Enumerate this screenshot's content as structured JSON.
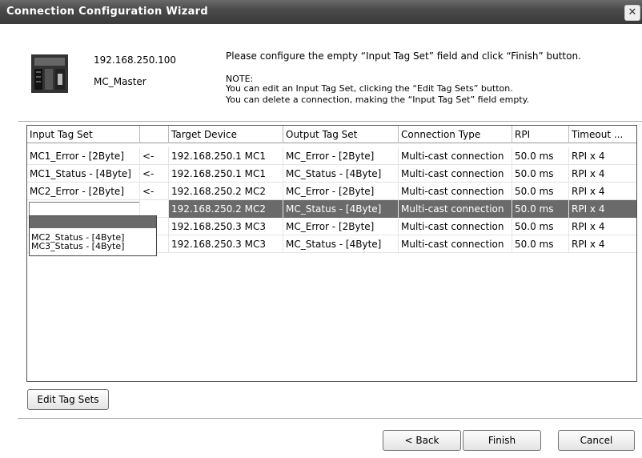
{
  "window": {
    "title": "Connection Configuration Wizard",
    "close_glyph": "✕"
  },
  "device": {
    "ip": "192.168.250.100",
    "name": "MC_Master",
    "icon": "plc-device-icon"
  },
  "instructions": {
    "main": "Please configure the empty “Input Tag Set” field and click “Finish” button.",
    "note_title": "NOTE:",
    "note_line1": "You can edit an Input Tag Set, clicking the “Edit Tag Sets” button.",
    "note_line2": "You can delete a connection, making the “Input Tag Set” field empty."
  },
  "table": {
    "columns": [
      "Input Tag Set",
      "",
      "Target Device",
      "Output Tag Set",
      "Connection Type",
      "RPI",
      "Timeout ..."
    ],
    "rows": [
      [
        "MC1_Error - [2Byte]",
        "<-",
        "192.168.250.1 MC1",
        "MC_Error - [2Byte]",
        "Multi-cast connection",
        "50.0 ms",
        "RPI x 4"
      ],
      [
        "MC1_Status - [4Byte]",
        "<-",
        "192.168.250.1 MC1",
        "MC_Status - [4Byte]",
        "Multi-cast connection",
        "50.0 ms",
        "RPI x 4"
      ],
      [
        "MC2_Error - [2Byte]",
        "<-",
        "192.168.250.2 MC2",
        "MC_Error - [2Byte]",
        "Multi-cast connection",
        "50.0 ms",
        "RPI x 4"
      ],
      [
        "",
        "",
        "192.168.250.2 MC2",
        "MC_Status - [4Byte]",
        "Multi-cast connection",
        "50.0 ms",
        "RPI x 4"
      ],
      [
        "",
        "",
        "192.168.250.3 MC3",
        "MC_Error - [2Byte]",
        "Multi-cast connection",
        "50.0 ms",
        "RPI x 4"
      ],
      [
        "",
        "",
        "192.168.250.3 MC3",
        "MC_Status - [4Byte]",
        "Multi-cast connection",
        "50.0 ms",
        "RPI x 4"
      ]
    ],
    "selected_row": 3,
    "dropdown_options": [
      "MC2_Status - [4Byte]",
      "MC3_Status - [4Byte]"
    ]
  },
  "buttons": {
    "edit_tag_sets": "Edit Tag Sets",
    "back": "< Back",
    "finish": "Finish",
    "cancel": "Cancel"
  }
}
